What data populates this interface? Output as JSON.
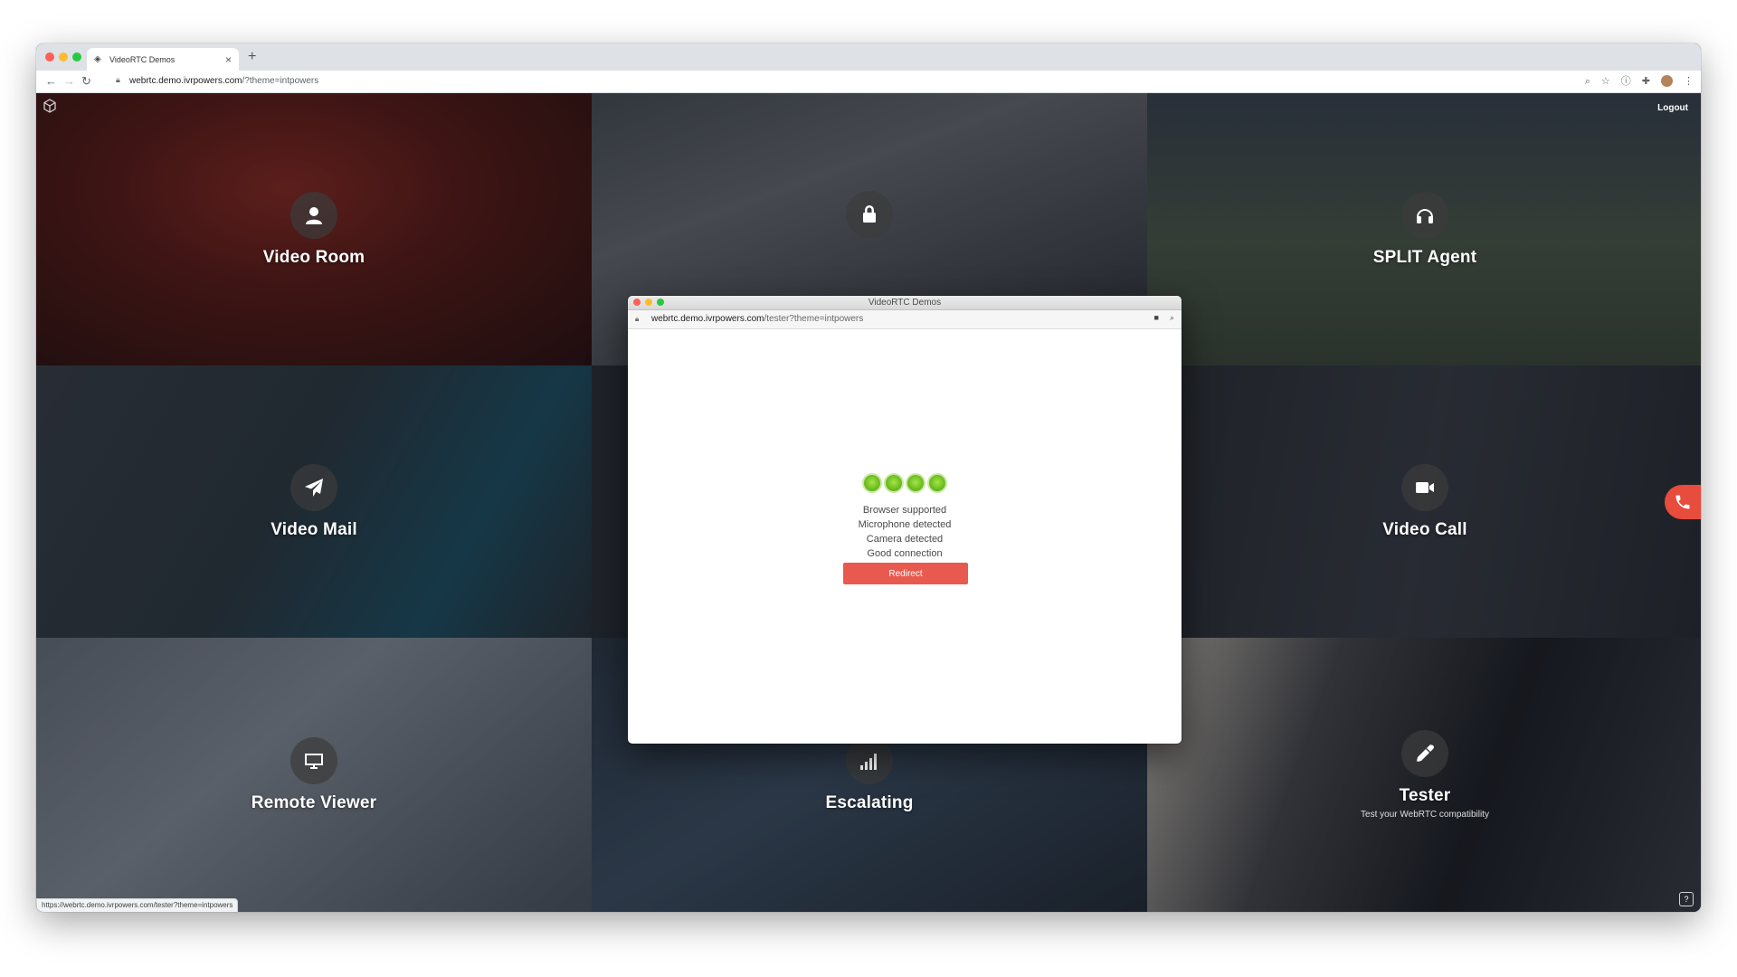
{
  "browser": {
    "tab_title": "VideoRTC Demos",
    "tab_close": "×",
    "new_tab": "+",
    "url_host": "webrtc.demo.ivrpowers.com",
    "url_path": "/?theme=intpowers",
    "status_url": "https://webrtc.demo.ivrpowers.com/tester?theme=intpowers"
  },
  "header": {
    "logout_label": "Logout"
  },
  "tiles": [
    {
      "label": "Video Room",
      "icon": "user-icon"
    },
    {
      "label": "",
      "icon": "lock-icon"
    },
    {
      "label": "SPLIT Agent",
      "icon": "headphones-icon"
    },
    {
      "label": "Video Mail",
      "icon": "paper-plane-icon"
    },
    {
      "label": "",
      "icon": ""
    },
    {
      "label": "Video Call",
      "icon": "video-camera-icon"
    },
    {
      "label": "Remote Viewer",
      "icon": "monitor-icon"
    },
    {
      "label": "Escalating",
      "icon": "signal-bars-icon"
    },
    {
      "label": "Tester",
      "subtitle": "Test your WebRTC compatibility",
      "icon": "eyedropper-icon"
    }
  ],
  "popup": {
    "title": "VideoRTC Demos",
    "url_host": "webrtc.demo.ivrpowers.com",
    "url_path": "/tester?theme=intpowers",
    "checks_passed": 4,
    "status_lines": [
      "Browser supported",
      "Microphone detected",
      "Camera detected",
      "Good connection"
    ],
    "redirect_label": "Redirect"
  },
  "colors": {
    "accent_red": "#e85a4f",
    "check_green": "#6fbf1f",
    "call_button": "#e74c3c"
  }
}
